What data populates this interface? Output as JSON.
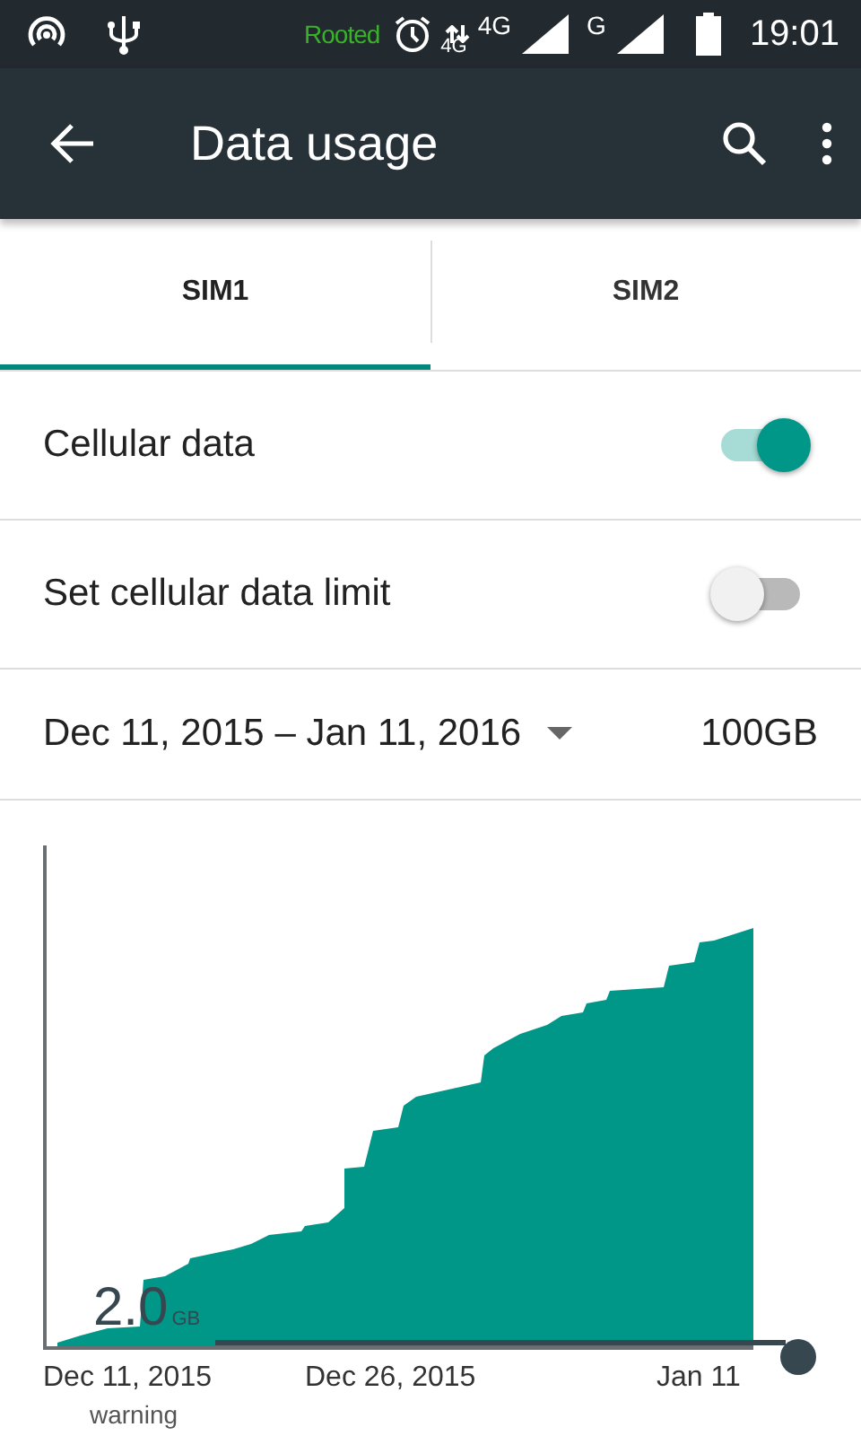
{
  "status_bar": {
    "rooted": "Rooted",
    "data_network": "4G",
    "network_1": "4G",
    "network_2": "G",
    "time": "19:01"
  },
  "app_bar": {
    "title": "Data usage"
  },
  "tabs": [
    {
      "label": "SIM1",
      "selected": true
    },
    {
      "label": "SIM2",
      "selected": false
    }
  ],
  "settings": [
    {
      "label": "Cellular data",
      "on": true
    },
    {
      "label": "Set cellular data limit",
      "on": false
    }
  ],
  "cycle": {
    "range": "Dec 11, 2015 – Jan 11, 2016",
    "total": "100GB"
  },
  "chart": {
    "warning_value": "2.0",
    "warning_unit": "GB",
    "warning_label": "warning",
    "x_labels": [
      "Dec 11, 2015",
      "Dec 26, 2015",
      "Jan 11"
    ]
  }
}
